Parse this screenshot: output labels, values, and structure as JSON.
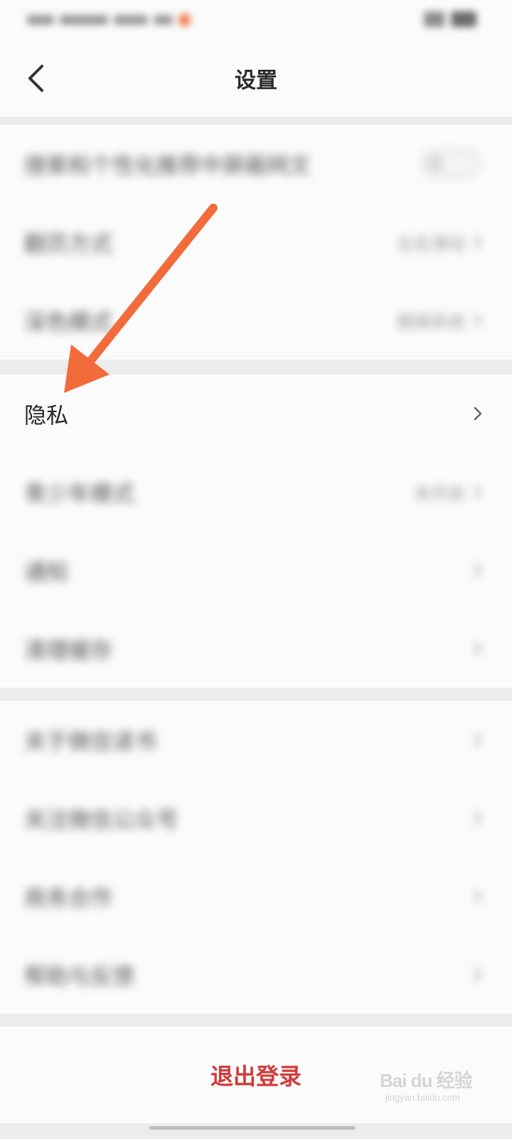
{
  "status_bar": {
    "time_blurred": "",
    "notification_dot_color": "#f07a4a"
  },
  "nav": {
    "back_icon": "chevron-left-icon",
    "title": "设置"
  },
  "groups": [
    {
      "items": [
        {
          "label": "搜索和个性化推荐中屏蔽网文",
          "control": "toggle",
          "toggle_on": false,
          "value": ""
        },
        {
          "label": "翻页方式",
          "control": "chevron",
          "value": "左右滑动"
        },
        {
          "label": "深色模式",
          "control": "chevron",
          "value": "跟随系统"
        }
      ]
    },
    {
      "items": [
        {
          "label": "隐私",
          "control": "chevron",
          "value": "",
          "highlighted": true
        },
        {
          "label": "青少年模式",
          "control": "chevron",
          "value": "未开启"
        },
        {
          "label": "通知",
          "control": "chevron",
          "value": ""
        },
        {
          "label": "清理缓存",
          "control": "chevron",
          "value": ""
        }
      ]
    },
    {
      "items": [
        {
          "label": "关于微信读书",
          "control": "chevron",
          "value": ""
        },
        {
          "label": "关注微信公众号",
          "control": "chevron",
          "value": ""
        },
        {
          "label": "商务合作",
          "control": "chevron",
          "value": ""
        },
        {
          "label": "帮助与反馈",
          "control": "chevron",
          "value": ""
        }
      ]
    }
  ],
  "logout": {
    "label": "退出登录",
    "color": "#d23a3a"
  },
  "watermark": {
    "text": "Bai du 经验",
    "subtext": "jingyan.baidu.com"
  },
  "annotation": {
    "arrow_color": "#f26b3a",
    "icon": "arrow-annotation-icon"
  }
}
